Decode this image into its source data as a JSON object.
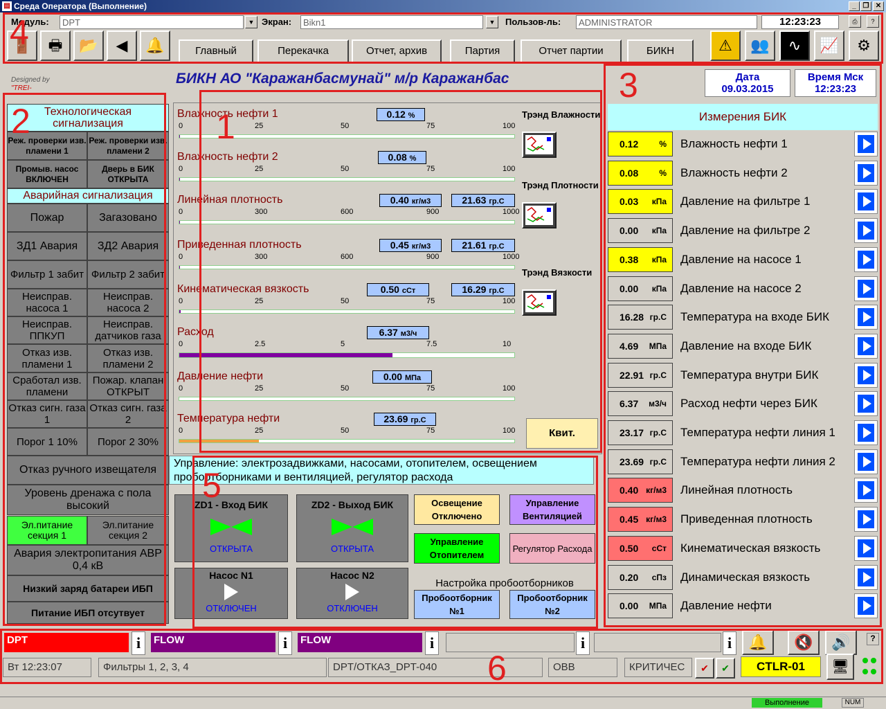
{
  "window": {
    "title": "Среда Оператора (Выполнение)"
  },
  "top": {
    "module_label": "Модуль:",
    "module_value": "DPT",
    "screen_label": "Экран:",
    "screen_value": "Bikn1",
    "user_label": "Пользов-ль:",
    "user_value": "ADMINISTRATOR",
    "time": "12:23:23",
    "nav": [
      "Главный",
      "Перекачка",
      "Отчет, архив",
      "Партия",
      "Отчет партии",
      "БИКН"
    ]
  },
  "header": {
    "designed_by": "Designed by",
    "trei": "\"TREI-",
    "title": "БИКН АО \"Каражанбасмунай\" м/р Каражанбас",
    "date_label": "Дата",
    "date": "09.03.2015",
    "time_label": "Время Мск",
    "time": "12:23:23"
  },
  "annotations": [
    "1",
    "2",
    "3",
    "4",
    "5",
    "6"
  ],
  "left": {
    "tech_header": "Технологическая сигнализация",
    "tech": [
      "Реж. проверки изв. пламени 1",
      "Реж. проверки изв. пламени 2",
      "Промыв. насос ВКЛЮЧЕН",
      "Дверь в БИК ОТКРЫТА"
    ],
    "emerg_header": "Аварийная сигнализация",
    "alarms": [
      "Пожар",
      "Загазовано",
      "ЗД1 Авария",
      "ЗД2 Авария",
      "Фильтр 1 забит",
      "Фильтр 2 забит",
      "Неисправ. насоса 1",
      "Неисправ. насоса 2",
      "Неисправ. ППКУП",
      "Неисправ. датчиков газа",
      "Отказ изв. пламени 1",
      "Отказ изв. пламени 2",
      "Сработал изв. пламени",
      "Пожар. клапан ОТКРЫТ",
      "Отказ сигн. газа 1",
      "Отказ сигн. газа 2",
      "Порог 1 10%",
      "Порог 2 30%"
    ],
    "manual_fail": "Отказ ручного извещателя",
    "drain": "Уровень дренажа с пола высокий",
    "power1": "Эл.питание секция 1",
    "power2": "Эл.питание секция 2",
    "avr": "Авария электропитания АВР 0,4 кВ",
    "ups_low": "Низкий заряд батареи ИБП",
    "ups_none": "Питание ИБП отсутвует"
  },
  "gauges": [
    {
      "label": "Влажность нефти 1",
      "value": "0.12",
      "unit": "%",
      "ticks": [
        "0",
        "25",
        "50",
        "75",
        "100"
      ],
      "fill": 0.0012,
      "color": "#8000a0"
    },
    {
      "label": "Влажность нефти 2",
      "value": "0.08",
      "unit": "%",
      "ticks": [
        "0",
        "25",
        "50",
        "75",
        "100"
      ],
      "fill": 0.0008,
      "color": "#8000a0"
    },
    {
      "label": "Линейная плотность",
      "value": "0.40",
      "unit": "кг/м3",
      "temp": "21.63",
      "temp_unit": "гр.С",
      "ticks": [
        "0",
        "300",
        "600",
        "900",
        "1000"
      ],
      "fill": 0.0004,
      "color": "#8000a0"
    },
    {
      "label": "Приведенная плотность",
      "value": "0.45",
      "unit": "кг/м3",
      "temp": "21.61",
      "temp_unit": "гр.С",
      "ticks": [
        "0",
        "300",
        "600",
        "900",
        "1000"
      ],
      "fill": 0.00045,
      "color": "#8000a0"
    },
    {
      "label": "Кинематическая вязкость",
      "value": "0.50",
      "unit": "сСт",
      "temp": "16.29",
      "temp_unit": "гр.С",
      "ticks": [
        "0",
        "25",
        "50",
        "75",
        "100"
      ],
      "fill": 0.005,
      "color": "#8000a0"
    },
    {
      "label": "Расход",
      "value": "6.37",
      "unit": "м3/ч",
      "ticks": [
        "0",
        "2.5",
        "5",
        "7.5",
        "10"
      ],
      "fill": 0.637,
      "color": "#8000a0"
    },
    {
      "label": "Давление нефти",
      "value": "0.00",
      "unit": "МПа",
      "ticks": [
        "0",
        "25",
        "50",
        "75",
        "100"
      ],
      "fill": 0,
      "color": "#8000a0"
    },
    {
      "label": "Температура нефти",
      "value": "23.69",
      "unit": "гр.С",
      "ticks": [
        "0",
        "25",
        "50",
        "75",
        "100"
      ],
      "fill": 0.2369,
      "color": "#f0a040"
    }
  ],
  "trends": [
    "Трэнд Влажности",
    "Трэнд Плотности",
    "Трэнд Вязкости"
  ],
  "kvit": "Квит.",
  "control": {
    "header": "Управление: электрозадвижками, насосами, отопителем, освещением пробоотборниками и вентиляцией, регулятор расхода",
    "zd1": "ZD1 - Вход БИК",
    "zd1_state": "ОТКРЫТА",
    "zd2": "ZD2 - Выход БИК",
    "zd2_state": "ОТКРЫТА",
    "pump1": "Насос N1",
    "pump1_state": "ОТКЛЮЧЕН",
    "pump2": "Насос N2",
    "pump2_state": "ОТКЛЮЧЕН",
    "light": "Освещение Отключено",
    "vent": "Управление Вентиляцией",
    "heater": "Управление Отопителем",
    "regulator": "Регулятор Расхода",
    "samplers_title": "Настройка пробоотборников",
    "sampler1": "Пробоотборник №1",
    "sampler2": "Пробоотборник №2"
  },
  "measurements": {
    "header": "Измерения БИК",
    "rows": [
      {
        "value": "0.12",
        "unit": "%",
        "name": "Влажность нефти 1",
        "color": "#ffff00"
      },
      {
        "value": "0.08",
        "unit": "%",
        "name": "Влажность нефти 2",
        "color": "#ffff00"
      },
      {
        "value": "0.03",
        "unit": "кПа",
        "name": "Давление на фильтре 1",
        "color": "#ffff00"
      },
      {
        "value": "0.00",
        "unit": "кПа",
        "name": "Давление на фильтре 2",
        "color": "#d4d0c8"
      },
      {
        "value": "0.38",
        "unit": "кПа",
        "name": "Давление на насосе 1",
        "color": "#ffff00"
      },
      {
        "value": "0.00",
        "unit": "кПа",
        "name": "Давление на насосе 2",
        "color": "#d4d0c8"
      },
      {
        "value": "16.28",
        "unit": "гр.С",
        "name": "Температура на входе БИК",
        "color": "#d4d0c8"
      },
      {
        "value": "4.69",
        "unit": "МПа",
        "name": "Давление на входе БИК",
        "color": "#d4d0c8"
      },
      {
        "value": "22.91",
        "unit": "гр.С",
        "name": "Температура внутри БИК",
        "color": "#d4d0c8"
      },
      {
        "value": "6.37",
        "unit": "м3/ч",
        "name": "Расход нефти через БИК",
        "color": "#d4d0c8"
      },
      {
        "value": "23.17",
        "unit": "гр.С",
        "name": "Температура нефти линия 1",
        "color": "#d4d0c8"
      },
      {
        "value": "23.69",
        "unit": "гр.С",
        "name": "Температура нефти линия 2",
        "color": "#d4d0c8"
      },
      {
        "value": "0.40",
        "unit": "кг/м3",
        "name": "Линейная плотность",
        "color": "#ff7070"
      },
      {
        "value": "0.45",
        "unit": "кг/м3",
        "name": "Приведенная плотность",
        "color": "#ff7070"
      },
      {
        "value": "0.50",
        "unit": "сСт",
        "name": "Кинематическая вязкость",
        "color": "#ff7070"
      },
      {
        "value": "0.20",
        "unit": "сПз",
        "name": "Динамическая вязкость",
        "color": "#d4d0c8"
      },
      {
        "value": "0.00",
        "unit": "МПа",
        "name": "Давление нефти",
        "color": "#d4d0c8"
      }
    ]
  },
  "bottom": {
    "events": [
      {
        "label": "DPT",
        "color": "#ff0000"
      },
      {
        "label": "FLOW",
        "color": "#800080"
      },
      {
        "label": "FLOW",
        "color": "#800080"
      }
    ],
    "info": "i",
    "status_time": "Вт 12:23:07",
    "status_msg": "Фильтры 1, 2, 3, 4",
    "status_tag": "DPT/ОТКАЗ_DPT-040",
    "status_ovv": "ОВВ",
    "status_level": "КРИТИЧЕС",
    "controller": "CTLR-01",
    "exec_status": "Выполнение",
    "num": "NUM"
  }
}
